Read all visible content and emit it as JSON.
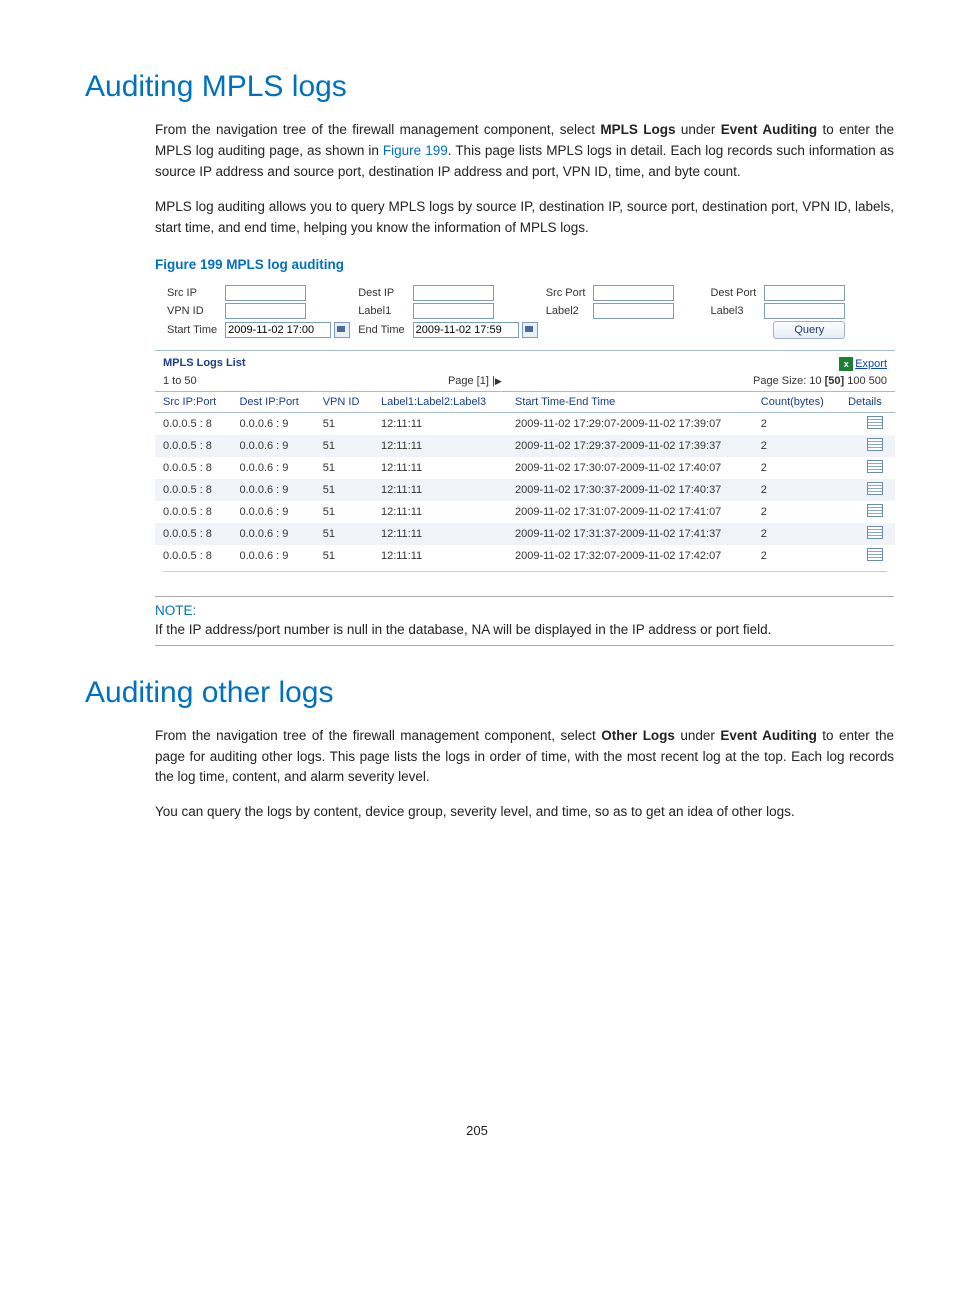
{
  "page_number": "205",
  "section1": {
    "heading": "Auditing MPLS logs",
    "para1_pre": "From the navigation tree of the firewall management component, select ",
    "para1_b1": "MPLS Logs",
    "para1_mid1": " under ",
    "para1_b2": "Event Auditing",
    "para1_mid2": " to enter the MPLS log auditing page, as shown in ",
    "para1_figref": "Figure 199",
    "para1_post": ". This page lists MPLS logs in detail. Each log records such information as source IP address and source port, destination IP address and port, VPN ID, time, and byte count.",
    "para2": "MPLS log auditing allows you to query MPLS logs by source IP, destination IP, source port, destination port, VPN ID, labels, start time, and end time, helping you know the information of MPLS logs.",
    "figcap": "Figure 199 MPLS log auditing"
  },
  "shot": {
    "labels": {
      "src_ip": "Src IP",
      "dest_ip": "Dest IP",
      "src_port": "Src Port",
      "dest_port": "Dest Port",
      "vpn_id": "VPN ID",
      "label1": "Label1",
      "label2": "Label2",
      "label3": "Label3",
      "start_time": "Start Time",
      "end_time": "End Time",
      "start_time_val": "2009-11-02 17:00",
      "end_time_val": "2009-11-02 17:59",
      "query": "Query"
    },
    "list_title": "MPLS Logs List",
    "export": "Export",
    "range": "1 to 50",
    "page_label": "Page [1] |",
    "page_arrow": "▶",
    "page_size_lead": "Page Size: 10 ",
    "page_size_current": "[50]",
    "page_size_rest": " 100 500",
    "cols": {
      "c1": "Src IP:Port",
      "c2": "Dest IP:Port",
      "c3": "VPN ID",
      "c4": "Label1:Label2:Label3",
      "c5": "Start Time-End Time",
      "c6": "Count(bytes)",
      "c7": "Details"
    },
    "rows": [
      {
        "a": "0.0.0.5 : 8",
        "b": "0.0.0.6 : 9",
        "c": "51",
        "d": "12:11:11",
        "e": "2009-11-02 17:29:07-2009-11-02 17:39:07",
        "f": "2"
      },
      {
        "a": "0.0.0.5 : 8",
        "b": "0.0.0.6 : 9",
        "c": "51",
        "d": "12:11:11",
        "e": "2009-11-02 17:29:37-2009-11-02 17:39:37",
        "f": "2"
      },
      {
        "a": "0.0.0.5 : 8",
        "b": "0.0.0.6 : 9",
        "c": "51",
        "d": "12:11:11",
        "e": "2009-11-02 17:30:07-2009-11-02 17:40:07",
        "f": "2"
      },
      {
        "a": "0.0.0.5 : 8",
        "b": "0.0.0.6 : 9",
        "c": "51",
        "d": "12:11:11",
        "e": "2009-11-02 17:30:37-2009-11-02 17:40:37",
        "f": "2"
      },
      {
        "a": "0.0.0.5 : 8",
        "b": "0.0.0.6 : 9",
        "c": "51",
        "d": "12:11:11",
        "e": "2009-11-02 17:31:07-2009-11-02 17:41:07",
        "f": "2"
      },
      {
        "a": "0.0.0.5 : 8",
        "b": "0.0.0.6 : 9",
        "c": "51",
        "d": "12:11:11",
        "e": "2009-11-02 17:31:37-2009-11-02 17:41:37",
        "f": "2"
      },
      {
        "a": "0.0.0.5 : 8",
        "b": "0.0.0.6 : 9",
        "c": "51",
        "d": "12:11:11",
        "e": "2009-11-02 17:32:07-2009-11-02 17:42:07",
        "f": "2"
      }
    ]
  },
  "note": {
    "title": "NOTE:",
    "body": "If the IP address/port number is null in the database, NA will be displayed in the IP address or port field."
  },
  "section2": {
    "heading": "Auditing other logs",
    "para1_pre": "From the navigation tree of the firewall management component, select ",
    "para1_b1": "Other Logs",
    "para1_mid1": " under ",
    "para1_b2": "Event Auditing",
    "para1_post": " to enter the page for auditing other logs. This page lists the logs in order of time, with the most recent log at the top. Each log records the log time, content, and alarm severity level.",
    "para2": "You can query the logs by content, device group, severity level, and time, so as to get an idea of other logs."
  }
}
